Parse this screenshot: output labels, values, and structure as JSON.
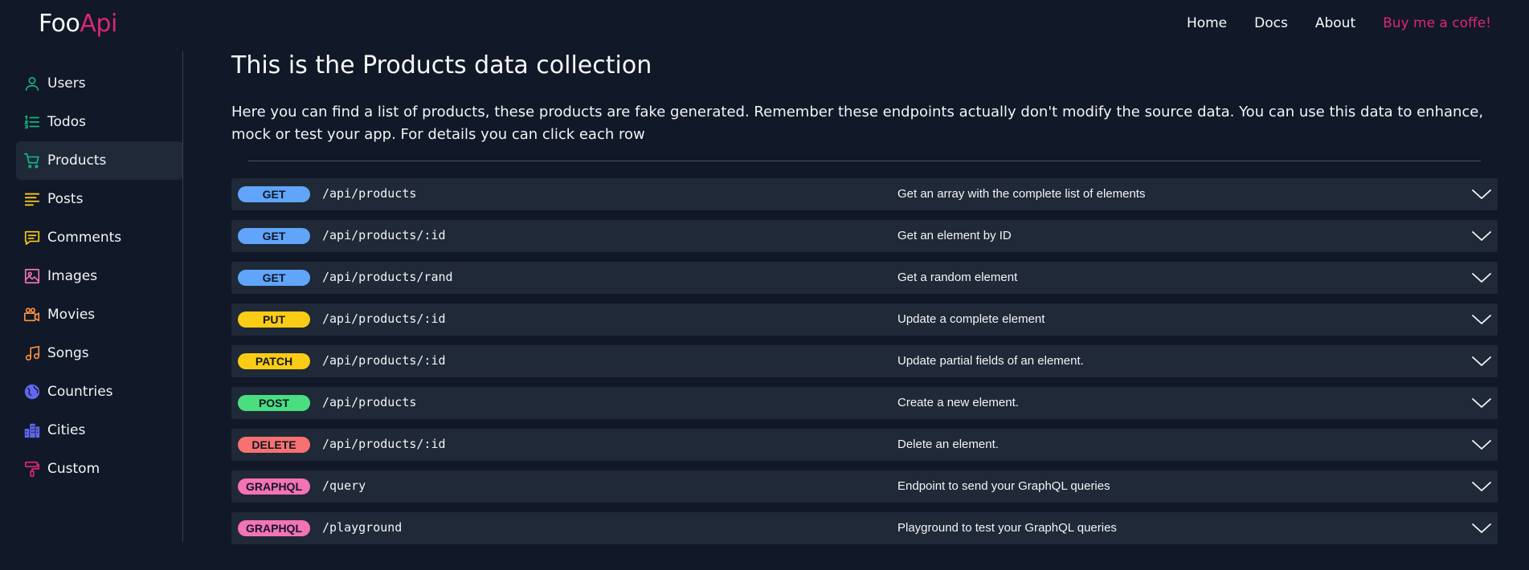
{
  "brand": {
    "foo": "Foo",
    "api": "Api"
  },
  "nav": {
    "home": "Home",
    "docs": "Docs",
    "about": "About",
    "coffee": "Buy me a coffe!"
  },
  "sidebar": {
    "items": [
      {
        "label": "Users",
        "icon": "user-icon",
        "color": "#10b981"
      },
      {
        "label": "Todos",
        "icon": "list-icon",
        "color": "#10b981"
      },
      {
        "label": "Products",
        "icon": "cart-icon",
        "color": "#10b981",
        "active": true
      },
      {
        "label": "Posts",
        "icon": "text-lines-icon",
        "color": "#facc15"
      },
      {
        "label": "Comments",
        "icon": "comment-icon",
        "color": "#facc15"
      },
      {
        "label": "Images",
        "icon": "image-icon",
        "color": "#f472b6"
      },
      {
        "label": "Movies",
        "icon": "movie-camera-icon",
        "color": "#fb923c"
      },
      {
        "label": "Songs",
        "icon": "music-note-icon",
        "color": "#fb923c"
      },
      {
        "label": "Countries",
        "icon": "globe-icon",
        "color": "#6366f1"
      },
      {
        "label": "Cities",
        "icon": "buildings-icon",
        "color": "#6366f1"
      },
      {
        "label": "Custom",
        "icon": "paint-roller-icon",
        "color": "#db2777"
      }
    ]
  },
  "main": {
    "title": "This is the Products data collection",
    "description": "Here you can find a list of products, these products are fake generated. Remember these endpoints actually don't modify the source data. You can use this data to enhance, mock or test your app. For details you can click each row"
  },
  "colors": {
    "GET": "#60a5fa",
    "PUT": "#facc15",
    "PATCH": "#facc15",
    "POST": "#4ade80",
    "DELETE": "#f87171",
    "GRAPHQL": "#f472b6"
  },
  "endpoints": [
    {
      "method": "GET",
      "path": "/api/products",
      "description": "Get an array with the complete list of elements"
    },
    {
      "method": "GET",
      "path": "/api/products/:id",
      "description": "Get an element by ID"
    },
    {
      "method": "GET",
      "path": "/api/products/rand",
      "description": "Get a random element"
    },
    {
      "method": "PUT",
      "path": "/api/products/:id",
      "description": "Update a complete element"
    },
    {
      "method": "PATCH",
      "path": "/api/products/:id",
      "description": "Update partial fields of an element."
    },
    {
      "method": "POST",
      "path": "/api/products",
      "description": "Create a new element."
    },
    {
      "method": "DELETE",
      "path": "/api/products/:id",
      "description": "Delete an element."
    },
    {
      "method": "GRAPHQL",
      "path": "/query",
      "description": "Endpoint to send your GraphQL queries"
    },
    {
      "method": "GRAPHQL",
      "path": "/playground",
      "description": "Playground to test your GraphQL queries"
    }
  ]
}
